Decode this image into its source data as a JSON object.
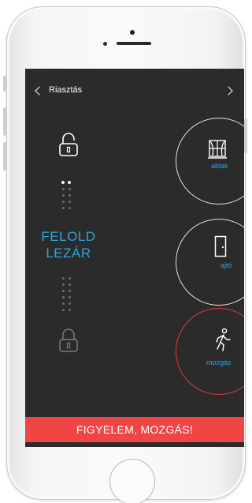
{
  "header": {
    "title": "Riasztás"
  },
  "lock_panel": {
    "unlock_label": "FELOLD",
    "lock_label": "LEZÁR"
  },
  "sensors": [
    {
      "label": "ablak",
      "icon": "window-icon",
      "status": "normal"
    },
    {
      "label": "ajtó",
      "icon": "door-icon",
      "status": "normal"
    },
    {
      "label": "mozgás",
      "icon": "motion-icon",
      "status": "alarm"
    }
  ],
  "alert": {
    "text": "FIGYELEM, MOZGÁS!"
  },
  "colors": {
    "screen_bg": "#2b2b2b",
    "accent_blue": "#2aa6de",
    "alert_red": "#f04545",
    "alarm_ring": "#e53935"
  }
}
